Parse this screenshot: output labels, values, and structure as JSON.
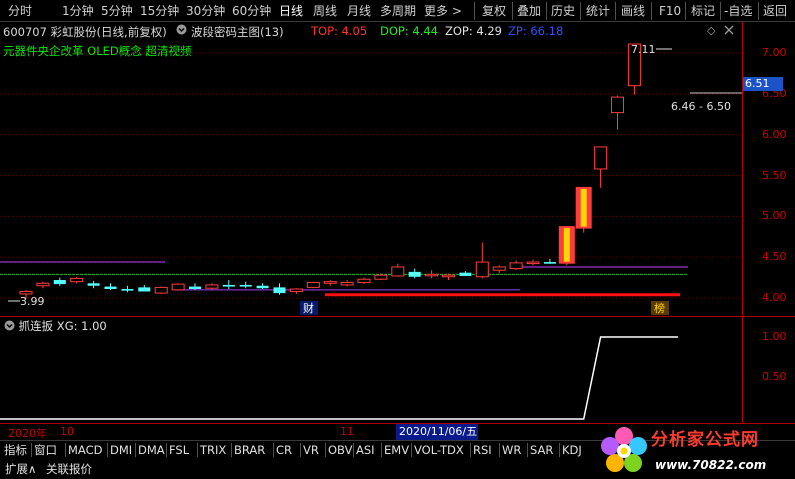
{
  "toolbar": {
    "left_items": [
      "分时",
      "1分钟",
      "5分钟",
      "15分钟",
      "30分钟",
      "60分钟",
      "日线",
      "周线",
      "月线",
      "多周期",
      "更多 >"
    ],
    "active": "日线",
    "right_items": [
      "复权",
      "叠加",
      "历史",
      "统计",
      "画线",
      "F10",
      "标记",
      "-自选",
      "返回"
    ]
  },
  "info": {
    "stock": "600707 彩虹股份(日线,前复权)",
    "indicator": "波段密码主图(13)",
    "top": "TOP: 4.05",
    "dop": "DOP: 4.44",
    "zop": "ZOP: 4.29",
    "zp": "ZP: 66.18"
  },
  "tags": "元器件央企改革 OLED概念 超清视频",
  "annotations": {
    "high_label": "7.11",
    "range_label": "6.46 - 6.50",
    "low_label": "3.99",
    "marker_cai": "财",
    "marker_bang": "榜"
  },
  "price_axis": {
    "ticks": [
      "7.00",
      "6.50",
      "6.00",
      "5.50",
      "5.00",
      "4.50",
      "4.00"
    ],
    "current": "6.51"
  },
  "indicator": {
    "header": "抓连扳 XG: 1.00",
    "ticks": [
      "1.00",
      "0.50"
    ]
  },
  "dates": {
    "year": "2020年",
    "m10": "10",
    "m11": "11",
    "highlight": "2020/11/06/五"
  },
  "tabs": [
    "指标",
    "窗口",
    "MACD",
    "DMI",
    "DMA",
    "FSL",
    "TRIX",
    "BRAR",
    "CR",
    "VR",
    "OBV",
    "ASI",
    "EMV",
    "VOL-TDX",
    "RSI",
    "WR",
    "SAR",
    "KDJ"
  ],
  "ext_tabs": [
    "扩展∧",
    "关联报价"
  ],
  "watermark": {
    "text": "分析家公式网",
    "url": "www.70822.com"
  },
  "colors": {
    "up": "#ff3c3c",
    "down": "#54ffff",
    "limit_up_body": "#ffd700",
    "limit_up_border": "#ff2020",
    "axis": "#d00000",
    "purple_line": "#c040ff",
    "green_line": "#20c020",
    "support_line": "#ff1010"
  },
  "chart_data": {
    "type": "candlestick",
    "ylim": [
      3.9,
      7.2
    ],
    "candles": [
      {
        "o": 4.05,
        "h": 4.1,
        "l": 3.99,
        "c": 4.08
      },
      {
        "o": 4.15,
        "h": 4.2,
        "l": 4.12,
        "c": 4.18
      },
      {
        "o": 4.22,
        "h": 4.25,
        "l": 4.15,
        "c": 4.17
      },
      {
        "o": 4.2,
        "h": 4.26,
        "l": 4.18,
        "c": 4.24
      },
      {
        "o": 4.18,
        "h": 4.21,
        "l": 4.12,
        "c": 4.15
      },
      {
        "o": 4.14,
        "h": 4.18,
        "l": 4.1,
        "c": 4.11
      },
      {
        "o": 4.11,
        "h": 4.15,
        "l": 4.07,
        "c": 4.09
      },
      {
        "o": 4.13,
        "h": 4.16,
        "l": 4.09,
        "c": 4.08
      },
      {
        "o": 4.06,
        "h": 4.14,
        "l": 4.05,
        "c": 4.13
      },
      {
        "o": 4.1,
        "h": 4.18,
        "l": 4.09,
        "c": 4.17
      },
      {
        "o": 4.14,
        "h": 4.18,
        "l": 4.1,
        "c": 4.11
      },
      {
        "o": 4.12,
        "h": 4.18,
        "l": 4.1,
        "c": 4.16
      },
      {
        "o": 4.16,
        "h": 4.22,
        "l": 4.11,
        "c": 4.14
      },
      {
        "o": 4.16,
        "h": 4.2,
        "l": 4.12,
        "c": 4.14
      },
      {
        "o": 4.15,
        "h": 4.18,
        "l": 4.11,
        "c": 4.12
      },
      {
        "o": 4.13,
        "h": 4.18,
        "l": 4.04,
        "c": 4.06
      },
      {
        "o": 4.08,
        "h": 4.12,
        "l": 4.05,
        "c": 4.11
      },
      {
        "o": 4.13,
        "h": 4.2,
        "l": 4.12,
        "c": 4.19
      },
      {
        "o": 4.18,
        "h": 4.22,
        "l": 4.15,
        "c": 4.2
      },
      {
        "o": 4.16,
        "h": 4.22,
        "l": 4.14,
        "c": 4.19
      },
      {
        "o": 4.19,
        "h": 4.25,
        "l": 4.17,
        "c": 4.23
      },
      {
        "o": 4.23,
        "h": 4.3,
        "l": 4.22,
        "c": 4.28
      },
      {
        "o": 4.27,
        "h": 4.42,
        "l": 4.26,
        "c": 4.38
      },
      {
        "o": 4.32,
        "h": 4.36,
        "l": 4.24,
        "c": 4.26
      },
      {
        "o": 4.28,
        "h": 4.34,
        "l": 4.24,
        "c": 4.29
      },
      {
        "o": 4.26,
        "h": 4.3,
        "l": 4.22,
        "c": 4.28
      },
      {
        "o": 4.31,
        "h": 4.33,
        "l": 4.27,
        "c": 4.27
      },
      {
        "o": 4.26,
        "h": 4.68,
        "l": 4.24,
        "c": 4.44
      },
      {
        "o": 4.34,
        "h": 4.4,
        "l": 4.3,
        "c": 4.38
      },
      {
        "o": 4.36,
        "h": 4.46,
        "l": 4.34,
        "c": 4.43
      },
      {
        "o": 4.43,
        "h": 4.47,
        "l": 4.4,
        "c": 4.44
      },
      {
        "o": 4.44,
        "h": 4.48,
        "l": 4.42,
        "c": 4.42
      },
      {
        "o": 4.42,
        "h": 4.88,
        "l": 4.4,
        "c": 4.88
      },
      {
        "o": 4.85,
        "h": 5.36,
        "l": 4.8,
        "c": 5.36
      },
      {
        "o": 5.58,
        "h": 5.85,
        "l": 5.35,
        "c": 5.85
      },
      {
        "o": 6.27,
        "h": 6.48,
        "l": 6.06,
        "c": 6.46
      },
      {
        "o": 6.6,
        "h": 7.11,
        "l": 6.49,
        "c": 7.11
      }
    ],
    "lines": {
      "purple": 4.38,
      "green": 4.29,
      "support": 4.04
    },
    "indicator_series": {
      "name": "XG",
      "values": [
        0,
        0,
        0,
        0,
        0,
        0,
        0,
        0,
        0,
        0,
        0,
        0,
        0,
        0,
        0,
        0,
        0,
        0,
        0,
        0,
        0,
        0,
        0,
        0,
        0,
        0,
        0,
        0,
        0,
        0,
        0,
        0,
        0,
        0,
        1,
        1,
        1
      ]
    }
  }
}
